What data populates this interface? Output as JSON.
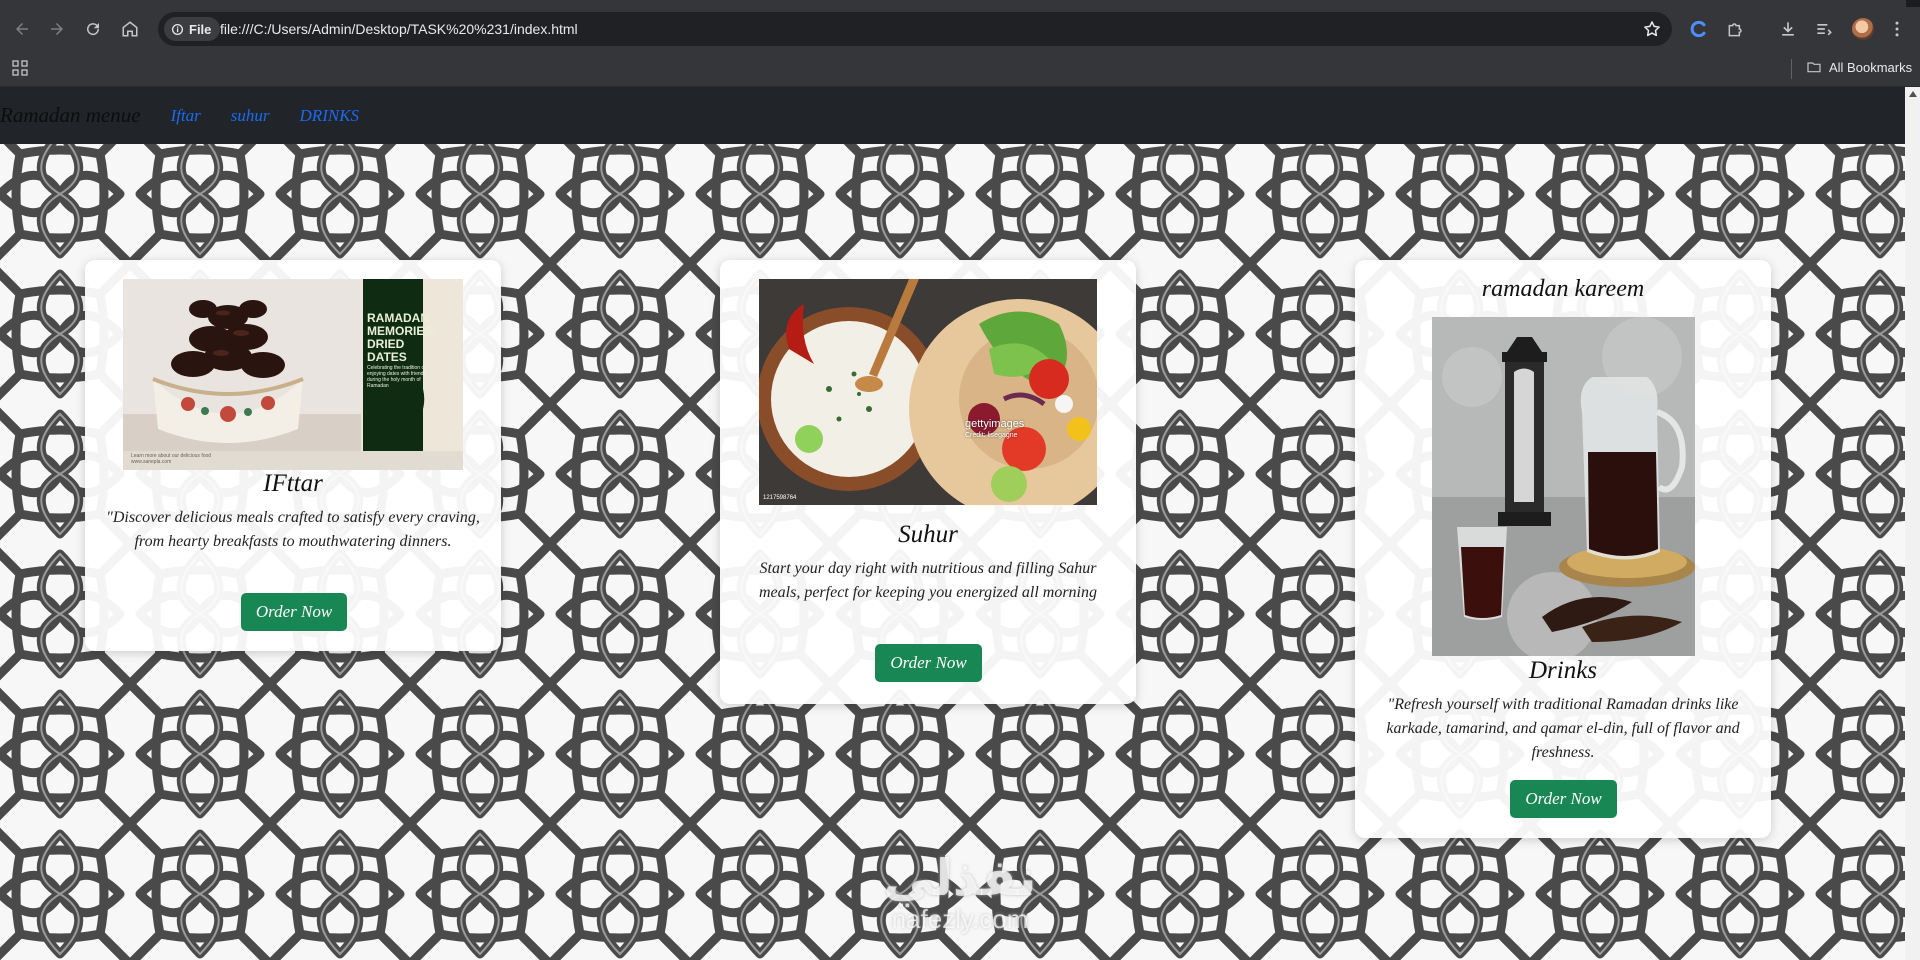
{
  "browser": {
    "address": {
      "chip_label": "File",
      "url": "file:///C:/Users/Admin/Desktop/TASK%20%231/index.html"
    },
    "bookmarks": {
      "all_bookmarks_label": "All Bookmarks"
    },
    "icons": [
      "back-arrow-icon",
      "forward-arrow-icon",
      "reload-icon",
      "home-icon",
      "info-icon",
      "star-icon",
      "extension-c-icon",
      "puzzle-icon",
      "download-icon",
      "reading-list-icon",
      "avatar",
      "kebab-menu-icon",
      "apps-grid-icon",
      "folder-icon"
    ],
    "colors": {
      "frame": "#35363a",
      "omnibox": "#202124",
      "text": "#e8eaed"
    }
  },
  "site": {
    "nav": {
      "brand": "Ramadan menue",
      "links": [
        "Iftar",
        "suhur",
        "DRINKS"
      ]
    },
    "cards": [
      {
        "title": "IFttar",
        "text": "\"Discover delicious meals crafted to satisfy every craving, from hearty breakfasts to mouthwatering dinners.",
        "button": "Order Now",
        "image": {
          "heading": "RAMADAN MEMORIES: DRIED DATES",
          "blurb": "Celebrating the tradition of enjoying dates with friends during the holy month of Ramadan",
          "footer": "Learn more about our delicious food www.sanepla.com"
        }
      },
      {
        "title": "Suhur",
        "text": "Start your day right with nutritious and filling Sahur meals, perfect for keeping you energized all morning",
        "button": "Order Now",
        "image": {
          "watermark": "gettyimages",
          "credit": "Credit: lisegagne",
          "photo_id": "1217598764"
        }
      },
      {
        "kicker": "ramadan kareem",
        "title": "Drinks",
        "text": "\"Refresh yourself with traditional Ramadan drinks like karkade, tamarind, and qamar el-din, full of flavor and freshness.",
        "button": "Order Now"
      }
    ],
    "watermark": {
      "arabic": "نفذلي",
      "latin": "nafezly.com"
    },
    "colors": {
      "nav_bg": "#212529",
      "link": "#1a6bf0",
      "button": "#198754"
    }
  }
}
